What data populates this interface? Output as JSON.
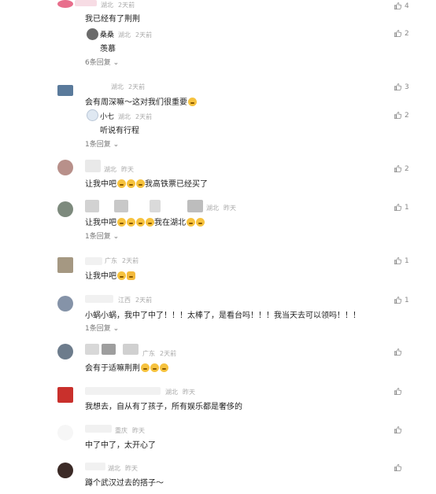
{
  "comments": [
    {
      "region": "湖北",
      "time": "2天前",
      "text": "我已经有了荆荆",
      "likes": "4",
      "more": "6条回复",
      "reply": {
        "name": "桑桑",
        "region": "湖北",
        "time": "2天前",
        "text": "羡慕",
        "likes": "2"
      }
    },
    {
      "region": "湖北",
      "time": "2天前",
      "text": "会有周深嘛～这对我们很重要",
      "likes": "3",
      "more": "1条回复",
      "reply": {
        "name": "小七",
        "region": "湖北",
        "time": "2天前",
        "text": "听说有行程",
        "likes": "2"
      }
    },
    {
      "region": "湖北",
      "time": "昨天",
      "text": "让我中吧",
      "text2": "我高铁票已经买了",
      "likes": "2"
    },
    {
      "region": "湖北",
      "time": "昨天",
      "text": "让我中吧",
      "text2": "我在湖北",
      "likes": "1",
      "more": "1条回复"
    },
    {
      "region": "广东",
      "time": "2天前",
      "text": "让我中吧",
      "likes": "1"
    },
    {
      "region": "江西",
      "time": "2天前",
      "text": "小蜗小蜗，我中了中了！！！太棒了，是看台吗！！！我当天去可以领吗！！！",
      "likes": "1",
      "more": "1条回复"
    },
    {
      "region": "广东",
      "time": "2天前",
      "text": "会有于适嘛荆荆",
      "likes": ""
    },
    {
      "region": "湖北",
      "time": "昨天",
      "text": "我想去，自从有了孩子，所有娱乐都是奢侈的",
      "likes": ""
    },
    {
      "region": "重庆",
      "time": "昨天",
      "text": "中了中了，太开心了",
      "likes": ""
    },
    {
      "region": "湖北",
      "time": "昨天",
      "text": "蹲个武汉过去的搭子～",
      "likes": ""
    }
  ],
  "colors": {
    "accent": "#f6c23e",
    "meta": "#a8a8a8"
  },
  "icons": {
    "like": "thumbs-up-icon",
    "expand": "chevron-down-icon",
    "emoji": "emoji-icon"
  }
}
